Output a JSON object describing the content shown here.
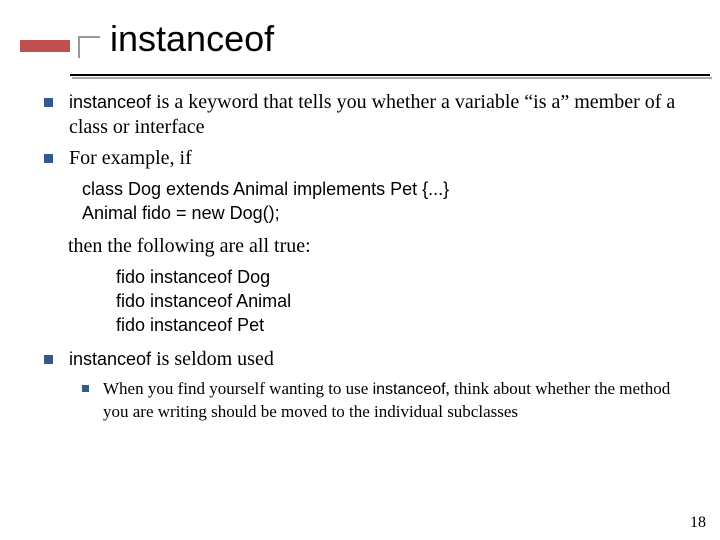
{
  "title": "instanceof",
  "bullets": {
    "b1_part1": "instanceof",
    "b1_part2": " is a keyword that tells you whether a variable “is a” member of a class or interface",
    "b2": "For example, if",
    "code1_l1": "class Dog extends Animal implements Pet {...}",
    "code1_l2": "Animal fido = new Dog();",
    "then_line": "then the following are all true:",
    "code2_l1": "fido instanceof Dog",
    "code2_l2": "fido instanceof Animal",
    "code2_l3": "fido instanceof Pet",
    "b3_part1": "instanceof",
    "b3_part2": " is seldom used",
    "sub_part1": "When you find yourself wanting to use ",
    "sub_part2": "instanceof",
    "sub_part3": ", think about whether the method you are writing should be moved to the individual subclasses"
  },
  "page_number": "18"
}
